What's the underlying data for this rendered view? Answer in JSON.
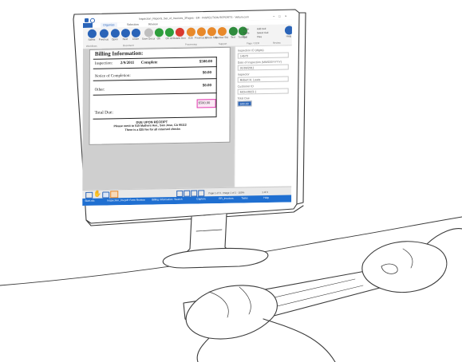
{
  "window": {
    "title": "Inspection_Reports_Set_of_Invoices_3Pages - ER - INSPECTION REPORTS - Vellum.com",
    "controls": [
      "–",
      "□",
      "×"
    ]
  },
  "ribbon": {
    "tabs": [
      "Organize",
      "Selection",
      "Review"
    ],
    "buttons": [
      {
        "label": "Select",
        "icon": "cursor-icon",
        "color": "#2a64b8"
      },
      {
        "label": "Previous",
        "icon": "arrow-left-icon",
        "color": "#2a64b8"
      },
      {
        "label": "Open",
        "icon": "open-icon",
        "color": "#2a64b8"
      },
      {
        "label": "Next",
        "icon": "arrow-right-icon",
        "color": "#2a64b8"
      },
      {
        "label": "Close",
        "icon": "close-icon",
        "color": "#2a64b8"
      },
      {
        "label": "Save Document",
        "icon": "save-icon",
        "color": "#bfbfbf"
      },
      {
        "label": "OK",
        "icon": "check-icon",
        "color": "#2e9e3c"
      },
      {
        "label": "OK All",
        "icon": "check-all-icon",
        "color": "#2e9e3c"
      },
      {
        "label": "Delete Document",
        "icon": "delete-icon",
        "color": "#d9392f"
      },
      {
        "label": "Exit",
        "icon": "exit-icon",
        "color": "#e8892a"
      },
      {
        "label": "Previous Skipped",
        "icon": "skip-back-icon",
        "color": "#e8892a"
      },
      {
        "label": "Check Skipped",
        "icon": "skip-check-icon",
        "color": "#e8892a"
      },
      {
        "label": "Review Skipped",
        "icon": "skip-review-icon",
        "color": "#e8892a"
      },
      {
        "label": "Text",
        "icon": "text-icon",
        "color": "#2e8b3c"
      },
      {
        "label": "Tooltips",
        "icon": "tooltip-icon",
        "color": "#2e8b3c"
      },
      {
        "label": "Help",
        "icon": "help-icon",
        "color": "#2a64b8"
      }
    ],
    "small_items": [
      "Copy",
      "Paste",
      "Cut",
      "Add Cell",
      "Select Cell",
      "Tiles",
      "Zoom",
      "Rotate"
    ],
    "groups": [
      "Workflows",
      "Document",
      "Processing",
      "Support",
      "Page / OCR",
      "Review"
    ]
  },
  "document": {
    "heading": "Billing Information:",
    "rows": [
      {
        "label": "Inspection:",
        "date": "2/9/2011",
        "status": "Complete",
        "amount": "$500.00"
      },
      {
        "label": "Notice of Completion:",
        "date": "",
        "status": "",
        "amount": "$0.00"
      },
      {
        "label": "Other:",
        "date": "",
        "status": "",
        "amount": "$0.00"
      }
    ],
    "total_label": "Total Due:",
    "total_value": "$500.00",
    "due_line": "DUE UPON RECEIPT",
    "remit_line": "Please remit to 515 Mathers Ave., San Jose, CA 95112",
    "fee_line": "There is a $25 fee for all returned checks"
  },
  "fields_panel": {
    "fields": [
      {
        "label": "Inspection ID (digits)",
        "value": "14570"
      },
      {
        "label": "Date of Inspection (MM/DD/YYYY)",
        "value": "01/09/2011"
      },
      {
        "label": "Inspector",
        "value": "Robert H. Lewis"
      },
      {
        "label": "Customer ID",
        "value": "MCH-0023-1"
      },
      {
        "label": "Total Due",
        "value": "500.00"
      }
    ]
  },
  "bottom_toolbar": {
    "tools": [
      {
        "name": "select-region-icon"
      },
      {
        "name": "pan-hand-icon"
      },
      {
        "name": "zoom-icon"
      },
      {
        "name": "capture-icon"
      }
    ],
    "zoom_controls": [
      "fit-page-icon",
      "fit-width-icon",
      "single-page-icon",
      "two-page-icon"
    ],
    "status": "Page 1 of 3 · Image 1 of 1 · 100%",
    "page_label": "1 of 3"
  },
  "taskbar": {
    "items": [
      "Start.rdc",
      "Inspection_Inv.pdf",
      "Form Review",
      "Billing Information",
      "Search",
      "Capture",
      "ER_Invoices",
      "Tasks",
      "Help"
    ]
  },
  "colors": {
    "ribbon_bg": "#f3f3f3",
    "title_bar": "#ffffff",
    "accent": "#2a64b8",
    "workspace_bg": "#cfcfcf",
    "taskbar": "#1f6fd1",
    "monitor_outline": "#3a3a3a",
    "highlight": "#e23bb0"
  }
}
